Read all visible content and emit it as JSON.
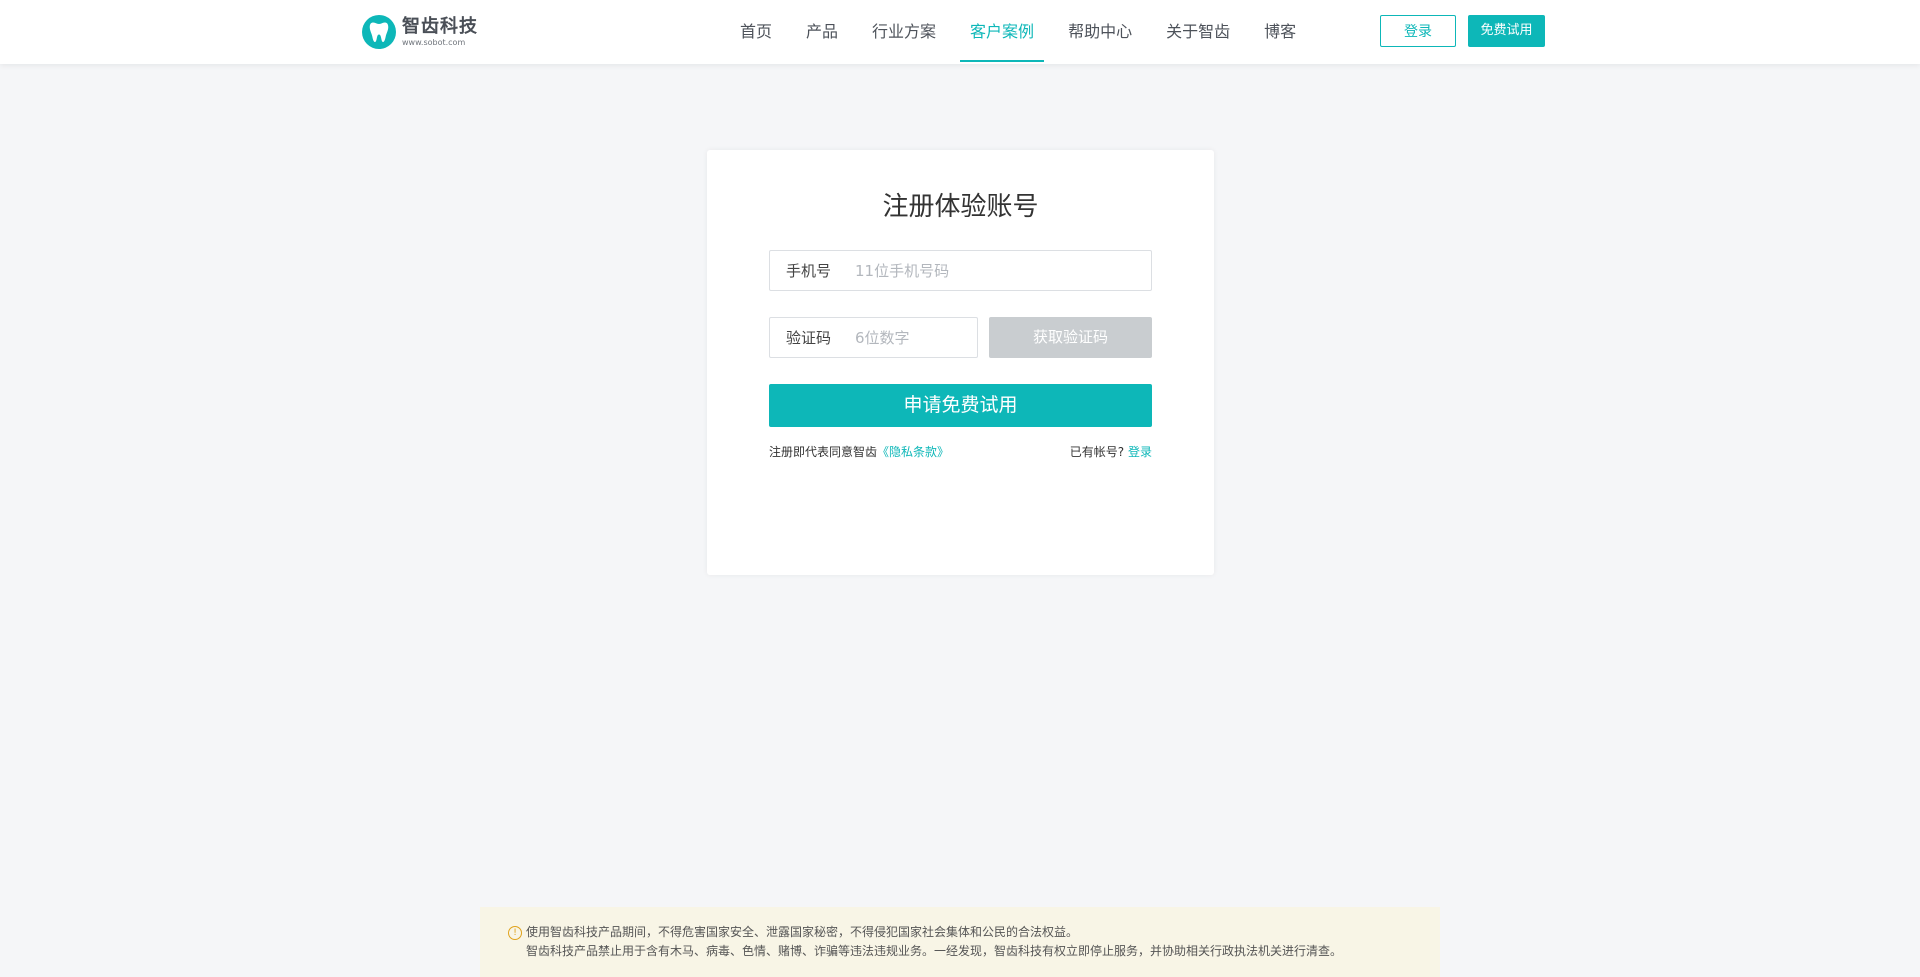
{
  "header": {
    "logo_name": "智齿科技",
    "logo_url": "www.sobot.com",
    "nav": [
      {
        "label": "首页"
      },
      {
        "label": "产品"
      },
      {
        "label": "行业方案"
      },
      {
        "label": "客户案例"
      },
      {
        "label": "帮助中心"
      },
      {
        "label": "关于智齿"
      },
      {
        "label": "博客"
      }
    ],
    "active_nav": "客户案例",
    "login_label": "登录",
    "trial_label": "免费试用"
  },
  "form": {
    "title": "注册体验账号",
    "phone_label": "手机号",
    "phone_placeholder": "11位手机号码",
    "code_label": "验证码",
    "code_placeholder": "6位数字",
    "get_code_label": "获取验证码",
    "submit_label": "申请免费试用",
    "agree_text": "注册即代表同意智齿",
    "privacy_link": "《隐私条款》",
    "has_account_text": "已有帐号?",
    "login_link": "登录"
  },
  "notice": {
    "line1": "使用智齿科技产品期间，不得危害国家安全、泄露国家秘密，不得侵犯国家社会集体和公民的合法权益。",
    "line2": "智齿科技产品禁止用于含有木马、病毒、色情、赌博、诈骗等违法违规业务。一经发现，智齿科技有权立即停止服务，并协助相关行政执法机关进行清查。"
  },
  "colors": {
    "accent": "#0db7b8",
    "disabled_button": "#c9cdd0",
    "page_background": "#f5f6f8",
    "notice_background": "#f8f5e6"
  }
}
